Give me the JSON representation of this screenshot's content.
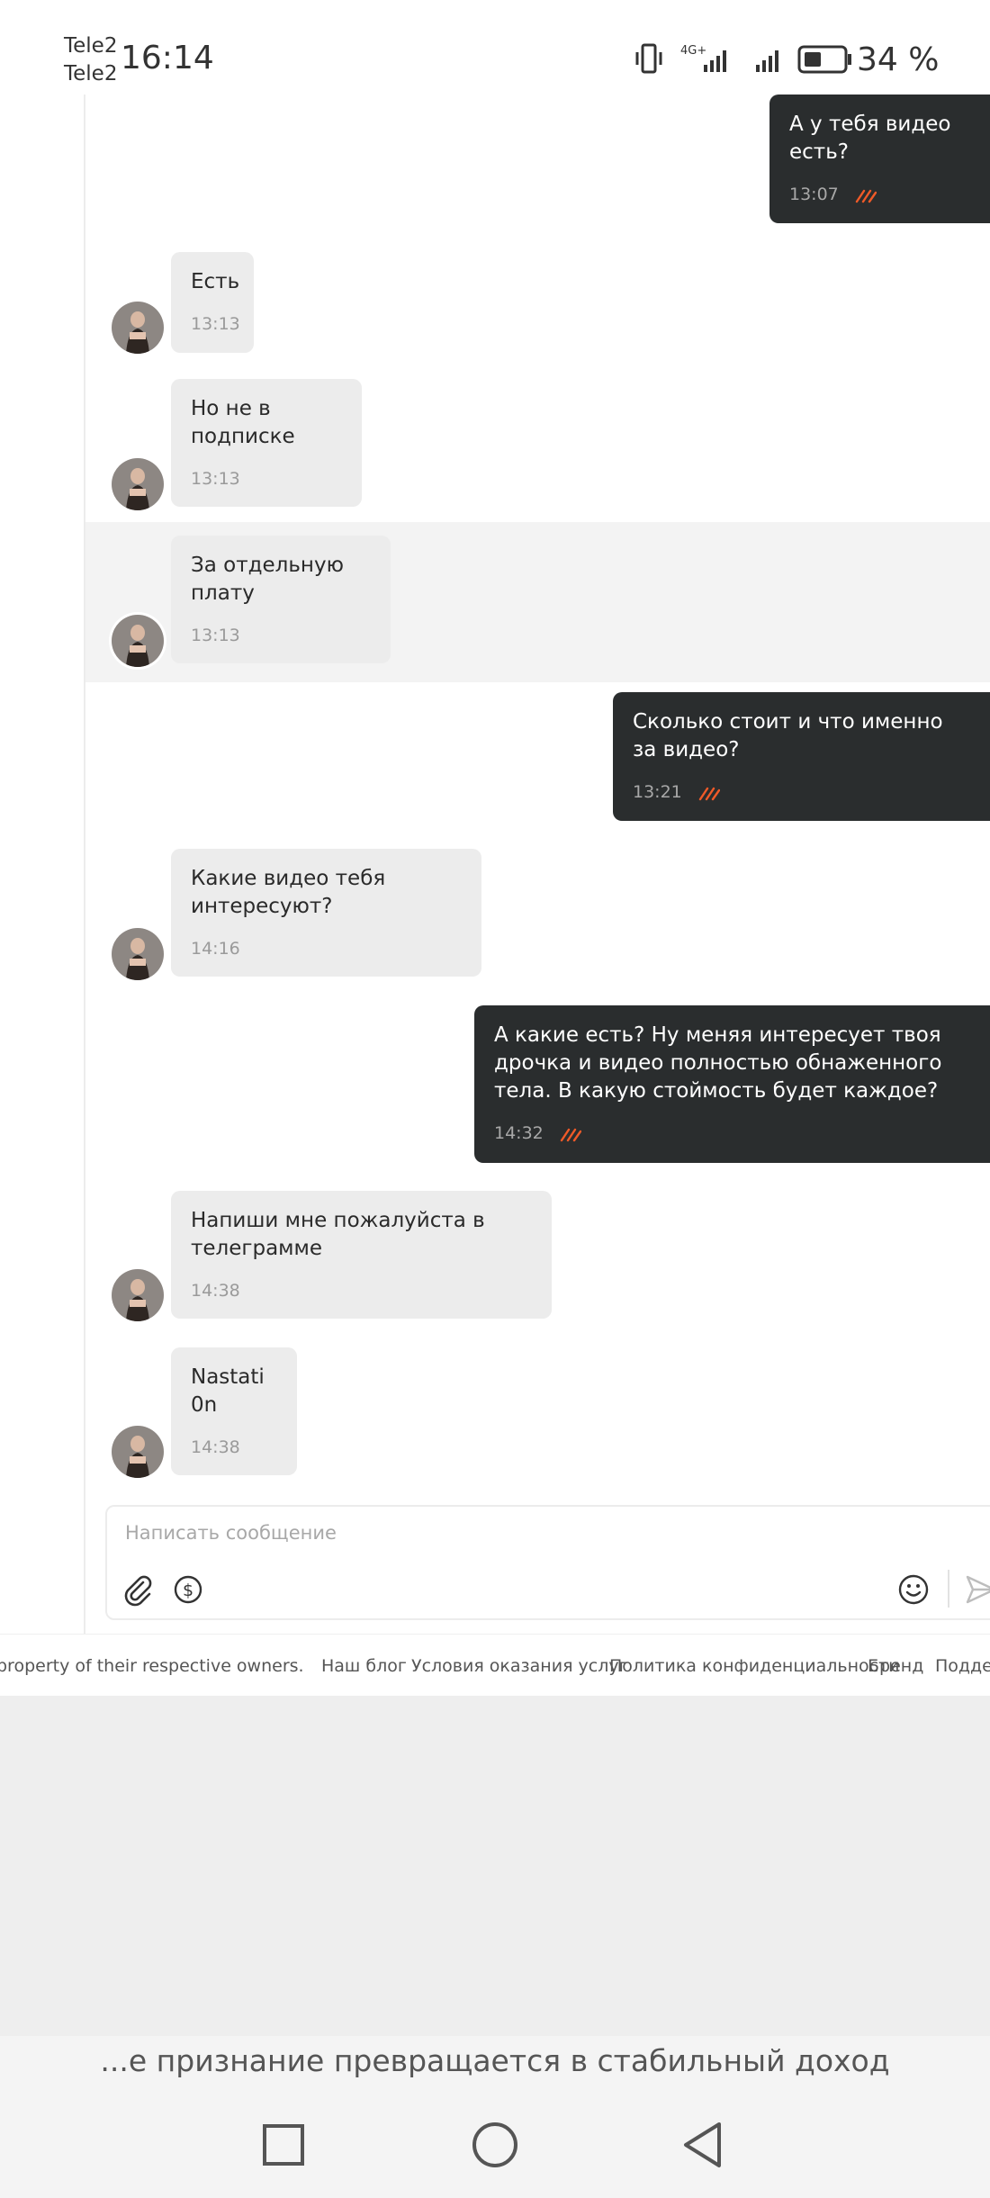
{
  "status_bar": {
    "carrier_1": "Tele2",
    "carrier_2": "Tele2",
    "time": "16:14",
    "network": "4G+",
    "battery": "34 %"
  },
  "messages": [
    {
      "dir": "out",
      "text": "А у тебя видео есть?",
      "time": "13:07",
      "read": true
    },
    {
      "dir": "in",
      "text": "Есть",
      "time": "13:13"
    },
    {
      "dir": "in",
      "text": "Но не в подписке",
      "time": "13:13"
    },
    {
      "dir": "in",
      "text": "За отдельную плату",
      "time": "13:13",
      "highlighted": true
    },
    {
      "dir": "out",
      "text": "Сколько стоит и что именно за видео?",
      "time": "13:21",
      "read": true
    },
    {
      "dir": "in",
      "text": "Какие видео тебя интересуют?",
      "time": "14:16"
    },
    {
      "dir": "out",
      "text": "А какие есть? Ну меняя интересует твоя дрочка и видео полностью обнаженного тела. В какую стоймость будет каждое?",
      "time": "14:32",
      "read": true
    },
    {
      "dir": "in",
      "text": "Напиши мне пожалуйста в телеграмме",
      "time": "14:38"
    },
    {
      "dir": "in",
      "text": "Nastati0n",
      "time": "14:38"
    }
  ],
  "composer": {
    "placeholder": "Написать сообщение",
    "icons": [
      "paperclip-icon",
      "dollar-icon",
      "emoji-icon",
      "send-icon"
    ]
  },
  "footer": {
    "copyright": "property of their respective owners.",
    "links": [
      "Наш блог",
      "Условия оказания услуг",
      "Политика конфиденциальности",
      "Бренд",
      "Поддер"
    ]
  },
  "promo_text": "...е признание превращается в стабильный доход",
  "colors": {
    "incoming_bubble": "#ececec",
    "outgoing_bubble": "#2a2d2e",
    "read_check": "#f05a28",
    "highlight_row": "#f3f3f3"
  }
}
